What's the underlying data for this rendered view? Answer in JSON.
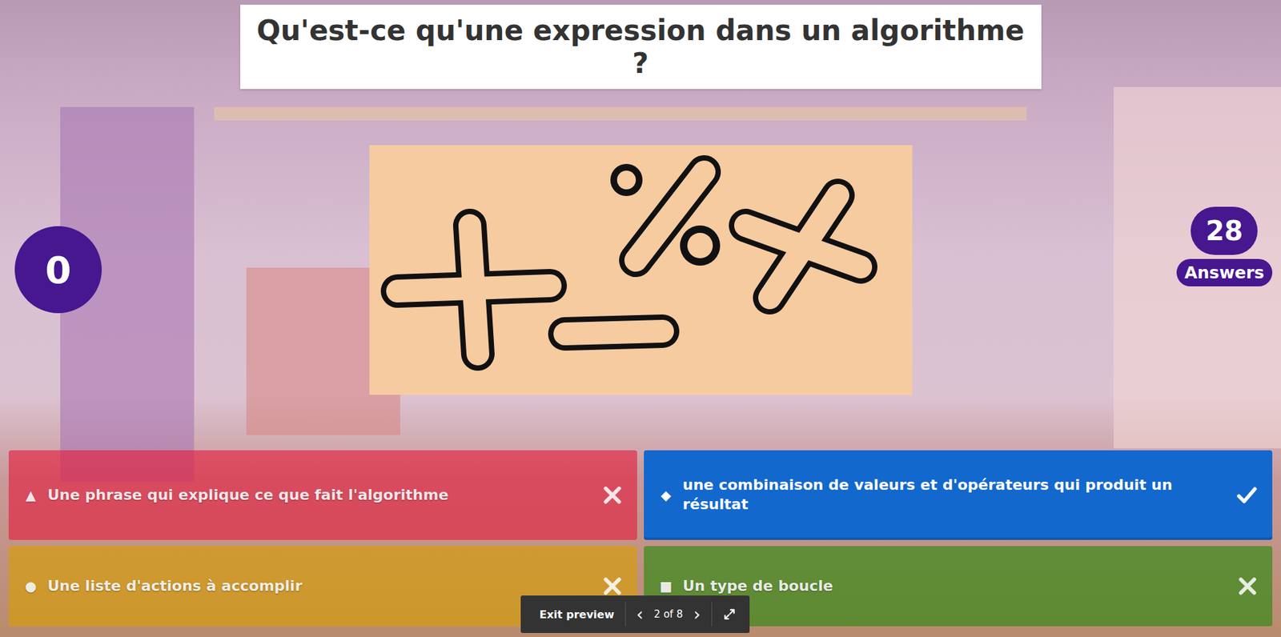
{
  "question": {
    "title": "Qu'est-ce qu'une expression dans un algorithme ?"
  },
  "score": {
    "value": "0"
  },
  "answers_count": {
    "value": "28",
    "label": "Answers"
  },
  "answers": [
    {
      "shape": "▲",
      "text": "Une phrase qui explique ce que fait l'algorithme",
      "correct": false,
      "color": "#e21b3c"
    },
    {
      "shape": "◆",
      "text": "une combinaison de valeurs et d'opérateurs qui produit un résultat",
      "correct": true,
      "color": "#1368ce"
    },
    {
      "shape": "●",
      "text": "Une liste d'actions à accomplir",
      "correct": false,
      "color": "#d89e00"
    },
    {
      "shape": "■",
      "text": "Un type de boucle",
      "correct": false,
      "color": "#26890c"
    }
  ],
  "preview_bar": {
    "exit": "Exit preview",
    "prev": "‹",
    "page": "2 of 8",
    "next": "›"
  }
}
